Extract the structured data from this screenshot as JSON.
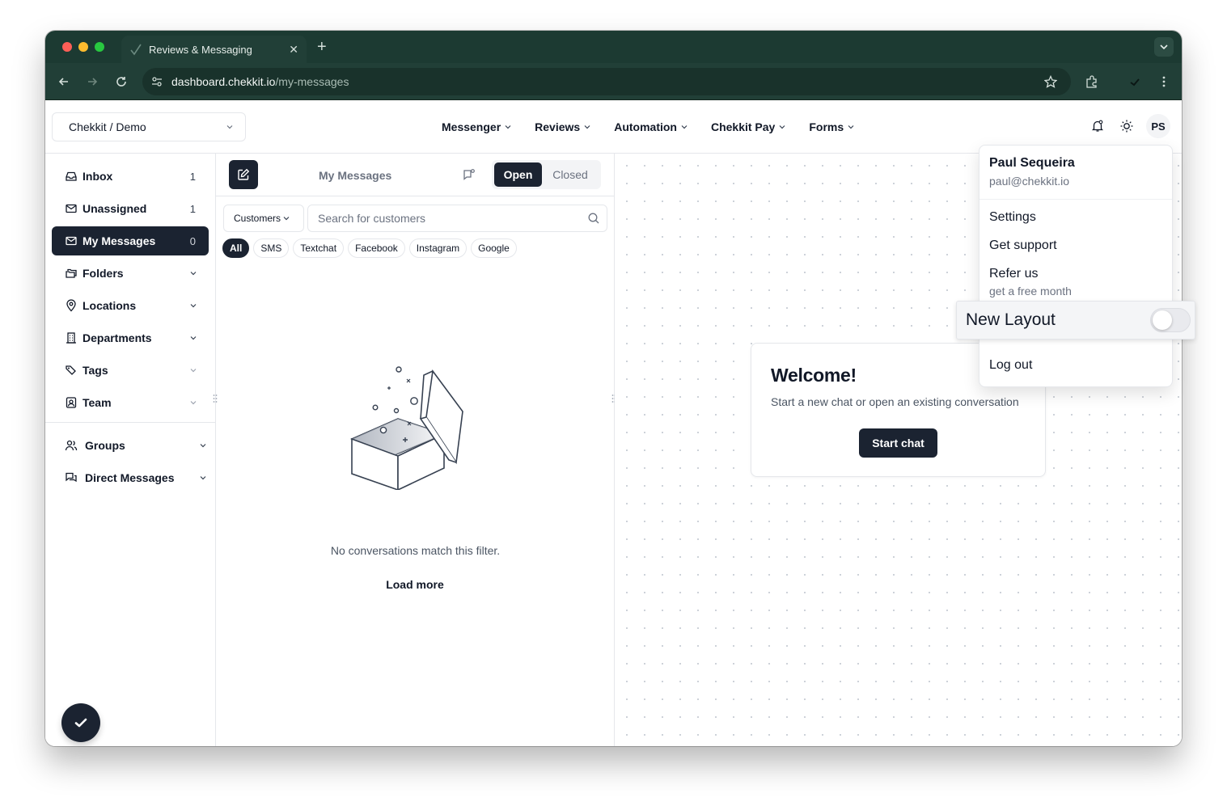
{
  "browser": {
    "tab_title": "Reviews & Messaging",
    "url_host": "dashboard.chekkit.io",
    "url_path": "/my-messages"
  },
  "header": {
    "org_selector": "Chekkit / Demo",
    "menu": [
      "Messenger",
      "Reviews",
      "Automation",
      "Chekkit Pay",
      "Forms"
    ],
    "avatar_initials": "PS"
  },
  "sidebar": {
    "items": [
      {
        "label": "Inbox",
        "count": "1",
        "icon": "inbox-icon"
      },
      {
        "label": "Unassigned",
        "count": "1",
        "icon": "mail-icon"
      },
      {
        "label": "My Messages",
        "count": "0",
        "icon": "mail-icon"
      },
      {
        "label": "Folders",
        "icon": "folders-icon"
      },
      {
        "label": "Locations",
        "icon": "map-pin-icon"
      },
      {
        "label": "Departments",
        "icon": "building-icon"
      },
      {
        "label": "Tags",
        "icon": "tags-icon"
      },
      {
        "label": "Team",
        "icon": "team-icon"
      }
    ],
    "groups": [
      {
        "label": "Groups",
        "icon": "users-icon"
      },
      {
        "label": "Direct Messages",
        "icon": "chat-icon"
      }
    ]
  },
  "messages_panel": {
    "title": "My Messages",
    "status_open": "Open",
    "status_closed": "Closed",
    "filter_select": "Customers",
    "search_placeholder": "Search for customers",
    "channels": [
      "All",
      "SMS",
      "Textchat",
      "Facebook",
      "Instagram",
      "Google"
    ],
    "active_channel": "All",
    "empty_text": "No conversations match this filter.",
    "load_more": "Load more"
  },
  "welcome": {
    "title": "Welcome!",
    "subtitle": "Start a new chat or open an existing conversation",
    "button": "Start chat"
  },
  "user_menu": {
    "name": "Paul Sequeira",
    "email": "paul@chekkit.io",
    "settings": "Settings",
    "support": "Get support",
    "refer": "Refer us",
    "refer_sub": "get a free month",
    "new_layout": "New Layout",
    "new_layout_enabled": false,
    "logout": "Log out"
  },
  "colors": {
    "chrome_dark": "#1c3a32",
    "primary": "#1b2331"
  }
}
